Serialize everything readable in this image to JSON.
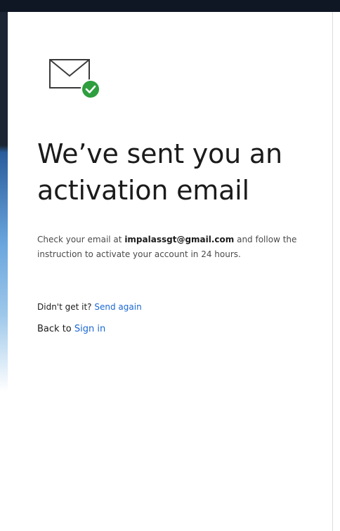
{
  "confirmation": {
    "icon": "mail-check-icon",
    "heading": "We’ve sent you an activation email",
    "message_prefix": "Check your email at ",
    "email": "impalassgt@gmail.com",
    "message_suffix": " and follow the instruction to activate your account in 24 hours.",
    "resend_prompt": "Didn't get it?",
    "resend_link": "Send again",
    "back_prefix": "Back to",
    "signin_link": "Sign in"
  },
  "colors": {
    "link": "#1a67d2",
    "check_badge": "#2e9e3e",
    "heading": "#1b1b1b",
    "body_text": "#4a4a4a"
  }
}
